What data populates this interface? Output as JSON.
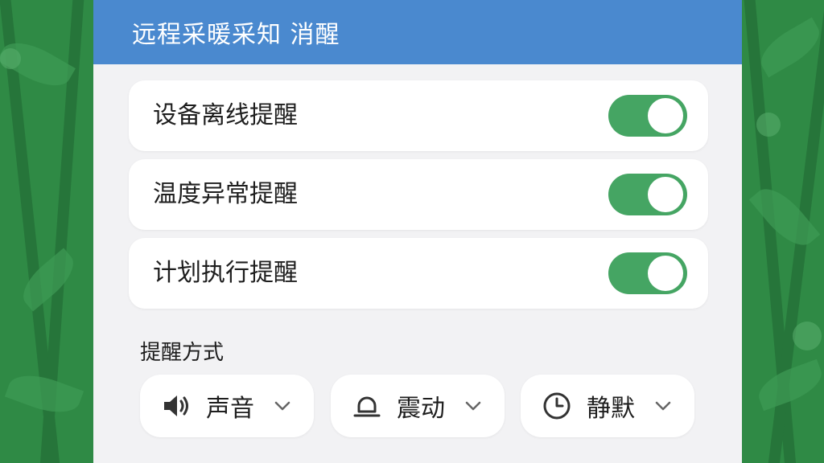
{
  "header": {
    "title": "远程采暖采知  消醒"
  },
  "alerts": [
    {
      "label": "设备离线提醒",
      "enabled": true
    },
    {
      "label": "温度异常提醒",
      "enabled": true
    },
    {
      "label": "计划执行提醒",
      "enabled": true
    }
  ],
  "method": {
    "title": "提醒方式",
    "options": [
      {
        "label": "声音",
        "icon": "speaker-icon"
      },
      {
        "label": "震动",
        "icon": "bell-icon"
      },
      {
        "label": "静默",
        "icon": "clock-icon"
      }
    ]
  },
  "colors": {
    "header": "#4a89cf",
    "toggle_on": "#45a563",
    "background": "#2f8a45"
  }
}
